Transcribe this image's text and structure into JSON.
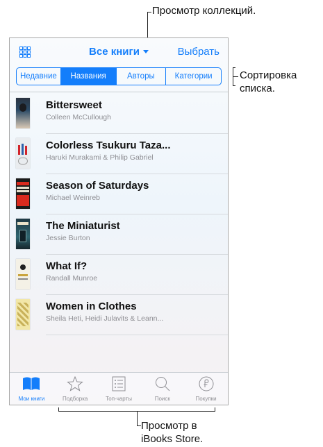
{
  "nav": {
    "title": "Все книги",
    "select_label": "Выбрать"
  },
  "segments": [
    "Недавние",
    "Названия",
    "Авторы",
    "Категории"
  ],
  "active_segment": 1,
  "books": [
    {
      "title": "Bittersweet",
      "author": "Colleen McCullough"
    },
    {
      "title": "Colorless Tsukuru Taza...",
      "author": "Haruki Murakami & Philip Gabriel"
    },
    {
      "title": "Season of Saturdays",
      "author": "Michael Weinreb"
    },
    {
      "title": "The Miniaturist",
      "author": "Jessie Burton"
    },
    {
      "title": "What If?",
      "author": "Randall Munroe"
    },
    {
      "title": "Women in Clothes",
      "author": "Sheila Heti, Heidi Julavits & Leann..."
    }
  ],
  "tabs": [
    {
      "label": "Мои книги",
      "icon": "open-book-icon",
      "active": true
    },
    {
      "label": "Подборка",
      "icon": "star-icon",
      "active": false
    },
    {
      "label": "Топ-чарты",
      "icon": "list-icon",
      "active": false
    },
    {
      "label": "Поиск",
      "icon": "magnifier-icon",
      "active": false
    },
    {
      "label": "Покупки",
      "icon": "purchases-icon",
      "active": false
    }
  ],
  "callouts": {
    "collections": "Просмотр коллекций.",
    "sorting": "Сортировка\nсписка.",
    "store": "Просмотр в\niBooks Store."
  },
  "colors": {
    "accent": "#147efb",
    "muted": "#8e8e93"
  }
}
